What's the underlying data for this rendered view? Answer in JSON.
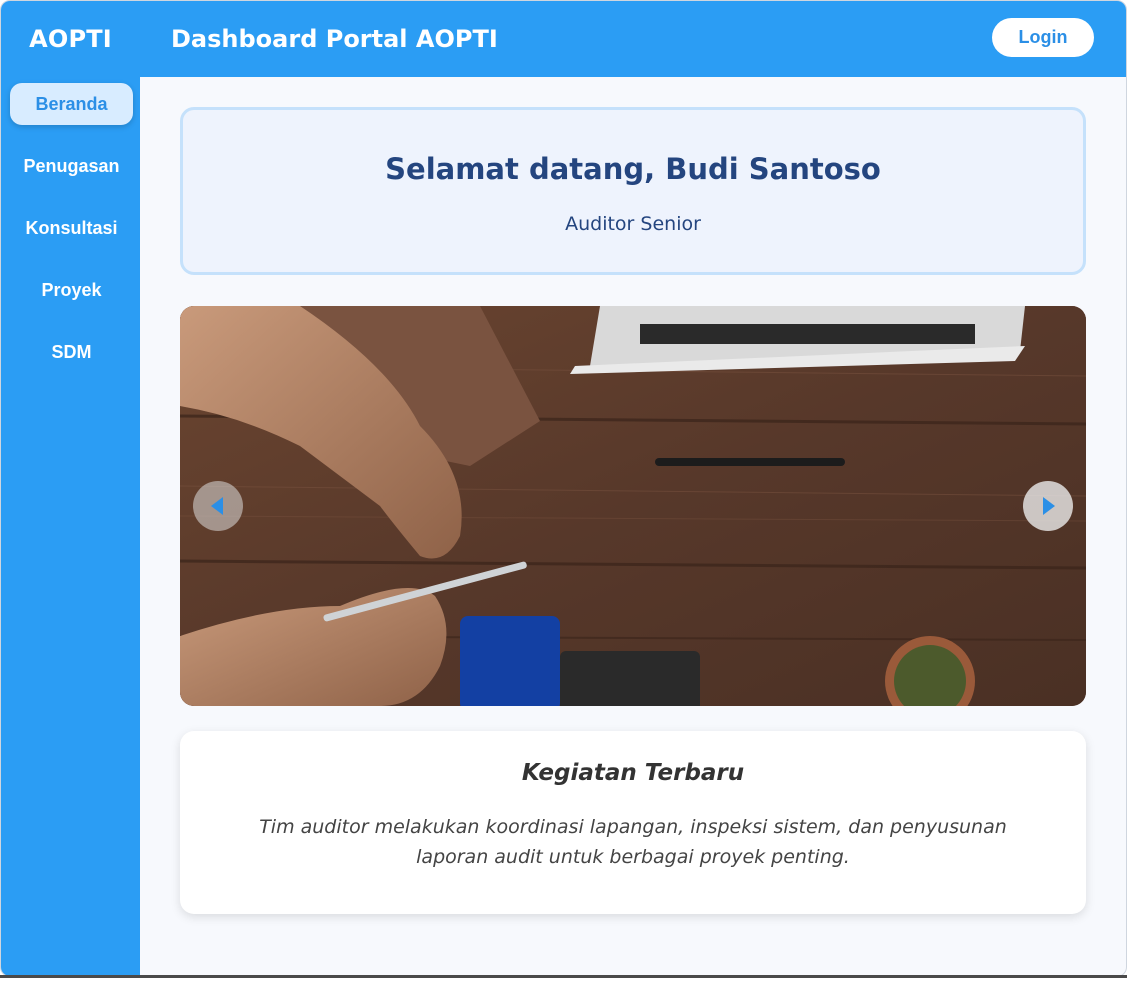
{
  "header": {
    "brand": "AOPTI",
    "title": "Dashboard Portal AOPTI",
    "login_label": "Login"
  },
  "sidebar": {
    "items": [
      {
        "label": "Beranda",
        "active": true
      },
      {
        "label": "Penugasan",
        "active": false
      },
      {
        "label": "Konsultasi",
        "active": false
      },
      {
        "label": "Proyek",
        "active": false
      },
      {
        "label": "SDM",
        "active": false
      }
    ]
  },
  "welcome": {
    "greeting": "Selamat datang, Budi Santoso",
    "role": "Auditor Senior"
  },
  "carousel": {
    "prev_icon": "chevron-left-icon",
    "next_icon": "chevron-right-icon"
  },
  "activity": {
    "title": "Kegiatan Terbaru",
    "text": "Tim auditor melakukan koordinasi lapangan, inspeksi sistem, dan penyusunan laporan audit untuk berbagai proyek penting."
  },
  "colors": {
    "primary": "#2b9df4",
    "heading": "#24457f",
    "active_bg": "#d8ecff"
  }
}
